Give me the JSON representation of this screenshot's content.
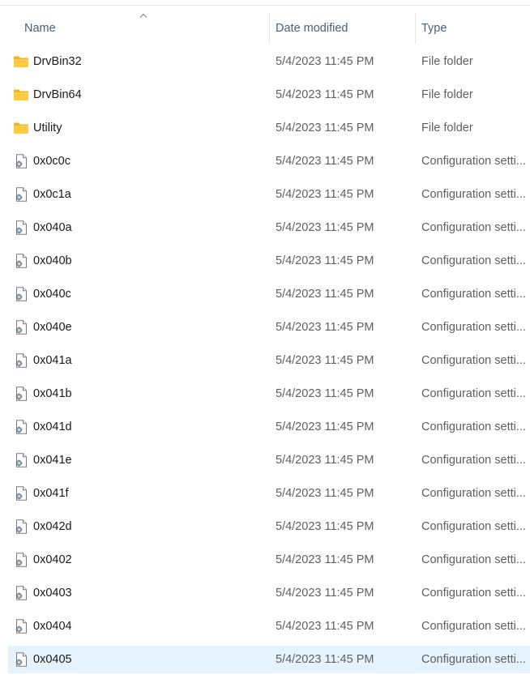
{
  "columns": {
    "name": "Name",
    "date_modified": "Date modified",
    "type": "Type",
    "sort_indicator": "chevron-up-icon"
  },
  "icons": {
    "folder": "folder-icon",
    "file": "configuration-file-icon"
  },
  "colors": {
    "folder_body": "#ffcb3d",
    "folder_tab": "#f0b429",
    "selected_row": "#e5f3ff",
    "header_text": "#4c607a"
  },
  "files": [
    {
      "name": "DrvBin32",
      "date": "5/4/2023 11:45 PM",
      "type": "File folder",
      "kind": "folder"
    },
    {
      "name": "DrvBin64",
      "date": "5/4/2023 11:45 PM",
      "type": "File folder",
      "kind": "folder"
    },
    {
      "name": "Utility",
      "date": "5/4/2023 11:45 PM",
      "type": "File folder",
      "kind": "folder"
    },
    {
      "name": "0x0c0c",
      "date": "5/4/2023 11:45 PM",
      "type": "Configuration setti...",
      "kind": "file"
    },
    {
      "name": "0x0c1a",
      "date": "5/4/2023 11:45 PM",
      "type": "Configuration setti...",
      "kind": "file"
    },
    {
      "name": "0x040a",
      "date": "5/4/2023 11:45 PM",
      "type": "Configuration setti...",
      "kind": "file"
    },
    {
      "name": "0x040b",
      "date": "5/4/2023 11:45 PM",
      "type": "Configuration setti...",
      "kind": "file"
    },
    {
      "name": "0x040c",
      "date": "5/4/2023 11:45 PM",
      "type": "Configuration setti...",
      "kind": "file"
    },
    {
      "name": "0x040e",
      "date": "5/4/2023 11:45 PM",
      "type": "Configuration setti...",
      "kind": "file"
    },
    {
      "name": "0x041a",
      "date": "5/4/2023 11:45 PM",
      "type": "Configuration setti...",
      "kind": "file"
    },
    {
      "name": "0x041b",
      "date": "5/4/2023 11:45 PM",
      "type": "Configuration setti...",
      "kind": "file"
    },
    {
      "name": "0x041d",
      "date": "5/4/2023 11:45 PM",
      "type": "Configuration setti...",
      "kind": "file"
    },
    {
      "name": "0x041e",
      "date": "5/4/2023 11:45 PM",
      "type": "Configuration setti...",
      "kind": "file"
    },
    {
      "name": "0x041f",
      "date": "5/4/2023 11:45 PM",
      "type": "Configuration setti...",
      "kind": "file"
    },
    {
      "name": "0x042d",
      "date": "5/4/2023 11:45 PM",
      "type": "Configuration setti...",
      "kind": "file"
    },
    {
      "name": "0x0402",
      "date": "5/4/2023 11:45 PM",
      "type": "Configuration setti...",
      "kind": "file"
    },
    {
      "name": "0x0403",
      "date": "5/4/2023 11:45 PM",
      "type": "Configuration setti...",
      "kind": "file"
    },
    {
      "name": "0x0404",
      "date": "5/4/2023 11:45 PM",
      "type": "Configuration setti...",
      "kind": "file"
    },
    {
      "name": "0x0405",
      "date": "5/4/2023 11:45 PM",
      "type": "Configuration setti...",
      "kind": "file",
      "selected": true
    }
  ]
}
